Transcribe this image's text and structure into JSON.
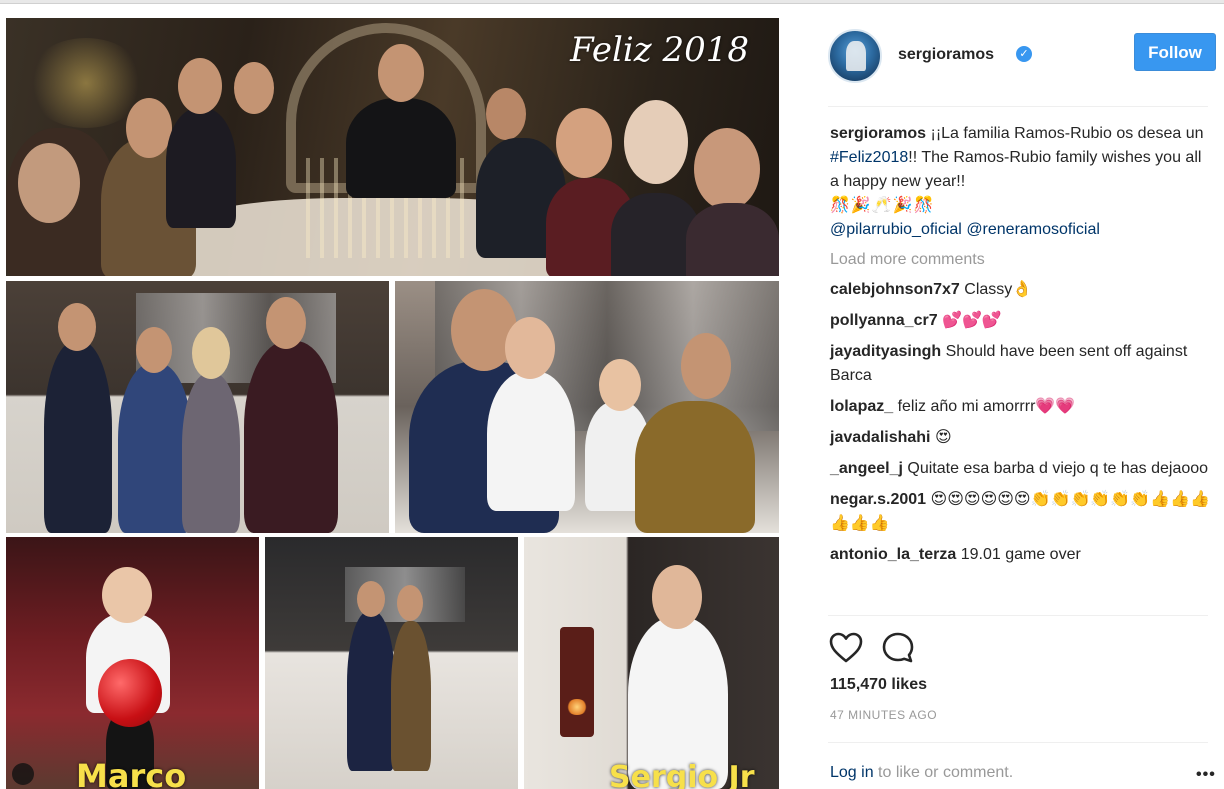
{
  "post": {
    "overlay_title": "Feliz 2018",
    "names": {
      "left": "Marco",
      "right": "Sergio Jr"
    }
  },
  "header": {
    "username": "sergioramos",
    "verified_mark": "✓",
    "follow_label": "Follow"
  },
  "caption": {
    "user": "sergioramos",
    "text_before_tag": " ¡¡La familia Ramos-Rubio os desea un ",
    "hashtag": "#Feliz2018",
    "text_after_tag": "!! The Ramos-Rubio family wishes you all a happy new year!!",
    "emojis": "🎊🎉🥂🎉🎊",
    "mention1": "@pilarrubio_oficial",
    "mention2": "@reneramosoficial"
  },
  "load_more": "Load more comments",
  "comments": [
    {
      "user": "calebjohnson7x7",
      "text": " Classy👌"
    },
    {
      "user": "pollyanna_cr7",
      "text": " 💕💕💕"
    },
    {
      "user": "jayadityasingh",
      "text": " Should have been sent off against Barca"
    },
    {
      "user": "lolapaz_",
      "text": " feliz año mi amorrrr💗💗"
    },
    {
      "user": "javadalishahi",
      "text": " 😍"
    },
    {
      "user": "_angeel_j",
      "text": " Quitate esa barba d viejo q te has dejaooo"
    },
    {
      "user": "negar.s.2001",
      "text": " 😍😍😍😍😍😍👏👏👏👏👏👏👍👍👍👍👍👍"
    },
    {
      "user": "antonio_la_terza",
      "text": " 19.01 game over"
    }
  ],
  "likes": "115,470 likes",
  "time_ago": "47 MINUTES AGO",
  "footer": {
    "login": "Log in",
    "rest": " to like or comment.",
    "more": "•••"
  },
  "icons": {
    "like": "heart-icon",
    "comment": "comment-bubble-icon",
    "verified": "verified-badge-icon"
  },
  "colors": {
    "accent": "#3897f0",
    "link": "#003569",
    "muted": "#999999",
    "overlay_name": "#f7e04a"
  }
}
